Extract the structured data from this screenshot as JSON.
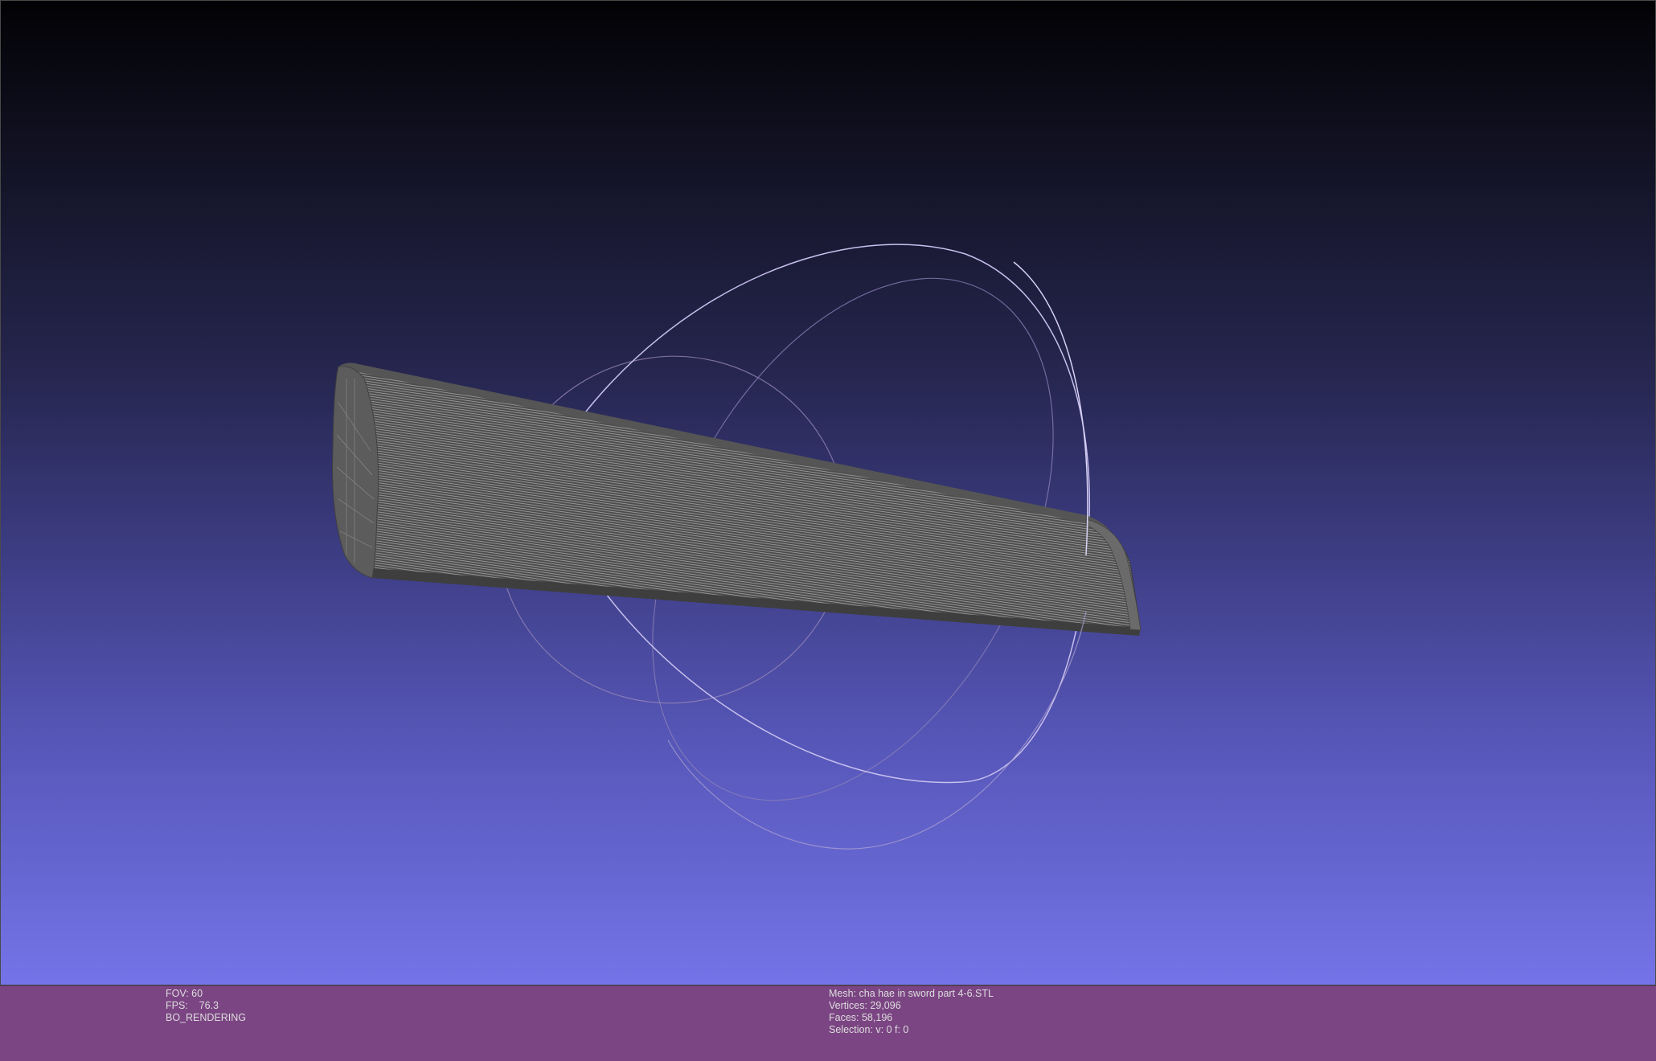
{
  "viewer": {
    "fov_label": "FOV: 60",
    "fps_label": "FPS:    76.3",
    "render_mode": "BO_RENDERING"
  },
  "mesh_info": {
    "mesh_label": "Mesh: cha hae in sword part 4-6.STL",
    "vertices_label": "Vertices: 29,096",
    "faces_label": "Faces: 58,196",
    "selection_label": "Selection: v: 0 f: 0"
  },
  "colors": {
    "background_top": "#020205",
    "background_bottom": "#7474e8",
    "statusbar": "#7b4583",
    "mesh": "#4a4a4a",
    "trackball_x": "#e8a8c8",
    "trackball_y": "#c8c8f0",
    "trackball_z": "#a8a8d8"
  },
  "icons": [
    "trackball-gizmo",
    "mesh-wireframe"
  ]
}
